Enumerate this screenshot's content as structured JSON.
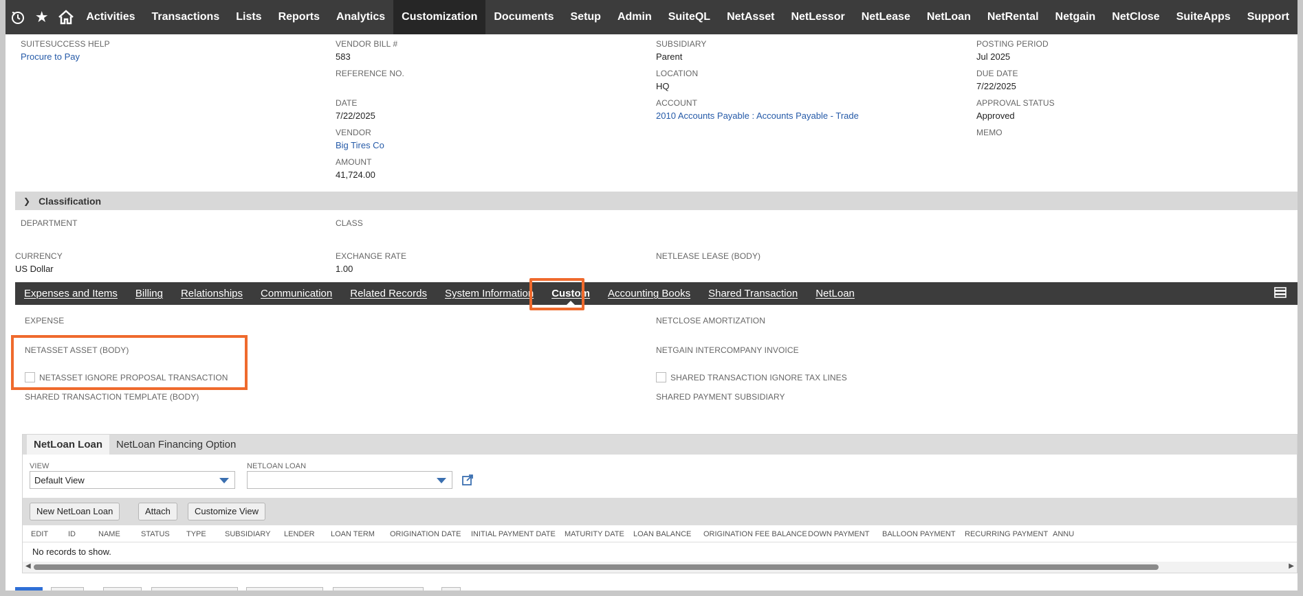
{
  "nav": {
    "icons": [
      "recent-records-icon",
      "star-icon",
      "home-icon"
    ],
    "items": [
      {
        "label": "Activities"
      },
      {
        "label": "Transactions"
      },
      {
        "label": "Lists"
      },
      {
        "label": "Reports"
      },
      {
        "label": "Analytics"
      },
      {
        "label": "Customization",
        "active": true
      },
      {
        "label": "Documents"
      },
      {
        "label": "Setup"
      },
      {
        "label": "Admin"
      },
      {
        "label": "SuiteQL"
      },
      {
        "label": "NetAsset"
      },
      {
        "label": "NetLessor"
      },
      {
        "label": "NetLease"
      },
      {
        "label": "NetLoan"
      },
      {
        "label": "NetRental"
      },
      {
        "label": "Netgain"
      },
      {
        "label": "NetClose"
      },
      {
        "label": "SuiteApps"
      },
      {
        "label": "Support"
      }
    ]
  },
  "primary": {
    "suitesuccess_help_label": "SUITESUCCESS HELP",
    "suitesuccess_help_value": "Procure to Pay",
    "vendor_bill_label": "VENDOR BILL #",
    "vendor_bill_value": "583",
    "reference_label": "REFERENCE NO.",
    "date_label": "DATE",
    "date_value": "7/22/2025",
    "vendor_label": "VENDOR",
    "vendor_value": "Big Tires Co",
    "amount_label": "AMOUNT",
    "amount_value": "41,724.00",
    "subsidiary_label": "SUBSIDIARY",
    "subsidiary_value": "Parent",
    "location_label": "LOCATION",
    "location_value": "HQ",
    "account_label": "ACCOUNT",
    "account_value": "2010 Accounts Payable : Accounts Payable - Trade",
    "posting_period_label": "POSTING PERIOD",
    "posting_period_value": "Jul 2025",
    "due_date_label": "DUE DATE",
    "due_date_value": "7/22/2025",
    "approval_status_label": "APPROVAL STATUS",
    "approval_status_value": "Approved",
    "memo_label": "MEMO"
  },
  "classification": {
    "title": "Classification",
    "department_label": "DEPARTMENT",
    "class_label": "CLASS",
    "currency_label": "CURRENCY",
    "currency_value": "US Dollar",
    "exchange_rate_label": "EXCHANGE RATE",
    "exchange_rate_value": "1.00",
    "netlease_label": "NETLEASE LEASE (BODY)"
  },
  "tabs": [
    {
      "label": "Expenses and Items"
    },
    {
      "label": "Billing"
    },
    {
      "label": "Relationships"
    },
    {
      "label": "Communication"
    },
    {
      "label": "Related Records"
    },
    {
      "label": "System Information"
    },
    {
      "label": "Custom",
      "active": true
    },
    {
      "label": "Accounting Books"
    },
    {
      "label": "Shared Transaction"
    },
    {
      "label": "NetLoan"
    }
  ],
  "custom": {
    "expense_label": "EXPENSE",
    "netasset_asset_label": "NETASSET ASSET (BODY)",
    "netasset_ignore_label": "NETASSET IGNORE PROPOSAL TRANSACTION",
    "shared_template_label": "SHARED TRANSACTION TEMPLATE (BODY)",
    "netclose_label": "NETCLOSE AMORTIZATION",
    "netgain_label": "NETGAIN INTERCOMPANY INVOICE",
    "shared_ignore_tax_label": "SHARED TRANSACTION IGNORE TAX LINES",
    "shared_payment_label": "SHARED PAYMENT SUBSIDIARY"
  },
  "netloan": {
    "subtabs": [
      {
        "label": "NetLoan Loan",
        "active": true
      },
      {
        "label": "NetLoan Financing Option"
      }
    ],
    "view_label": "VIEW",
    "view_value": "Default View",
    "netloan_loan_label": "NETLOAN LOAN",
    "netloan_loan_value": "",
    "buttons": {
      "new": "New NetLoan Loan",
      "attach": "Attach",
      "customize": "Customize View"
    },
    "columns": [
      "EDIT",
      "ID",
      "NAME",
      "STATUS",
      "TYPE",
      "SUBSIDIARY",
      "LENDER",
      "LOAN TERM",
      "ORIGINATION DATE",
      "INITIAL PAYMENT DATE",
      "MATURITY DATE",
      "LOAN BALANCE",
      "ORIGINATION FEE BALANCE",
      "DOWN PAYMENT",
      "BALLOON PAYMENT",
      "RECURRING PAYMENT",
      "ANNU"
    ],
    "empty_text": "No records to show."
  }
}
